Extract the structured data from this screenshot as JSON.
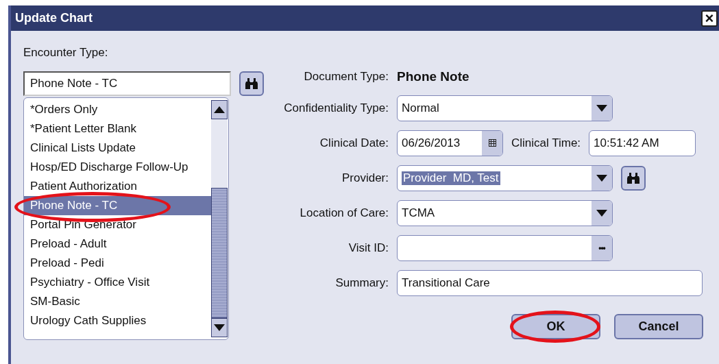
{
  "window": {
    "title": "Update Chart",
    "close": "×"
  },
  "encounter_type": {
    "label": "Encounter Type:",
    "value": "Phone Note - TC",
    "items": [
      {
        "label": "*Orders Only",
        "selected": false,
        "circled": false
      },
      {
        "label": "*Patient Letter Blank",
        "selected": false,
        "circled": false
      },
      {
        "label": "Clinical Lists Update",
        "selected": false,
        "circled": false
      },
      {
        "label": "Hosp/ED Discharge Follow-Up",
        "selected": false,
        "circled": false
      },
      {
        "label": "Patient Authorization",
        "selected": false,
        "circled": false
      },
      {
        "label": "Phone Note - TC",
        "selected": true,
        "circled": true
      },
      {
        "label": "Portal Pin Generator",
        "selected": false,
        "circled": false
      },
      {
        "label": "Preload - Adult",
        "selected": false,
        "circled": false
      },
      {
        "label": "Preload - Pedi",
        "selected": false,
        "circled": false
      },
      {
        "label": "Psychiatry - Office Visit",
        "selected": false,
        "circled": false
      },
      {
        "label": "SM-Basic",
        "selected": false,
        "circled": false
      },
      {
        "label": "Urology Cath Supplies",
        "selected": false,
        "circled": false
      }
    ]
  },
  "document_type": {
    "label": "Document Type:",
    "value": "Phone Note"
  },
  "confidentiality_type": {
    "label": "Confidentiality Type:",
    "value": "Normal"
  },
  "clinical_date": {
    "label": "Clinical Date:",
    "value": "06/26/2013"
  },
  "clinical_time": {
    "label": "Clinical Time:",
    "value": "10:51:42 AM"
  },
  "provider": {
    "label": "Provider:",
    "value": "Provider  MD, Test",
    "highlighted": true
  },
  "location_of_care": {
    "label": "Location of Care:",
    "value": "TCMA"
  },
  "visit_id": {
    "label": "Visit ID:",
    "button": "•••"
  },
  "summary": {
    "label": "Summary:",
    "value": "Transitional Care"
  },
  "buttons": [
    {
      "label": "OK",
      "circled": true
    },
    {
      "label": "Cancel",
      "circled": false
    }
  ]
}
